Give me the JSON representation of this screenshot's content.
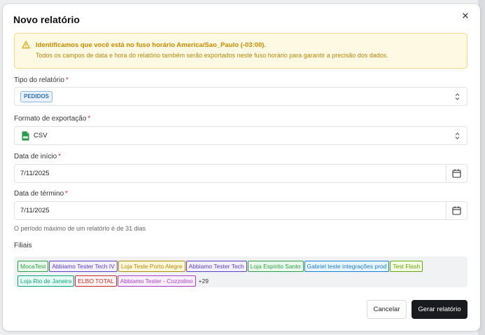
{
  "modal": {
    "title": "Novo relatório",
    "close_icon": "close-icon"
  },
  "alert": {
    "icon": "warning-triangle-icon",
    "title": "Identificamos que você está no fuso horário America/Sao_Paulo (-03:00).",
    "text": "Todos os campos de data e hora do relatório também serão exportados neste fuso horário para garantir a precisão dos dados."
  },
  "report_type": {
    "label": "Tipo do relatório",
    "required_mark": "*",
    "selected": "PEDIDOS",
    "icon": "chevron-up-down-icon"
  },
  "export_format": {
    "label": "Formato de exportação",
    "required_mark": "*",
    "selected": "CSV",
    "selected_icon": "csv-file-icon",
    "icon": "chevron-up-down-icon"
  },
  "start_date": {
    "label": "Data de início",
    "required_mark": "*",
    "value": "7/11/2025",
    "icon": "calendar-icon"
  },
  "end_date": {
    "label": "Data de término",
    "required_mark": "*",
    "value": "7/11/2025",
    "icon": "calendar-icon"
  },
  "helper_text": "O período máximo de um relatório é de 31 dias",
  "branches": {
    "label": "Filiais",
    "chips": [
      {
        "label": "MocaTest",
        "color": "#2f9e44",
        "bg": "#ebfbee"
      },
      {
        "label": "Abbiamo Tester Tech IV",
        "color": "#5f3dc4",
        "bg": "#f3f0ff"
      },
      {
        "label": "Loja Teste Porto Alegre",
        "color": "#b8860b",
        "bg": "#fff9db"
      },
      {
        "label": "Abbiamo Tester Tech",
        "color": "#5f3dc4",
        "bg": "#f3f0ff"
      },
      {
        "label": "Loja Espírito Santo",
        "color": "#2f9e44",
        "bg": "#ebfbee"
      },
      {
        "label": "Gabriel teste integrações prod",
        "color": "#1c7ed6",
        "bg": "#e7f5ff"
      },
      {
        "label": "Test Flash",
        "color": "#66a80f",
        "bg": "#f4fce3"
      },
      {
        "label": "Loja Rio de Janeiro",
        "color": "#0ca678",
        "bg": "#e6fcf5"
      },
      {
        "label": "ELBO TOTAL",
        "color": "#c92a2a",
        "bg": "#fff5f5"
      },
      {
        "label": "Abbiamo Tester - Cozzolino",
        "color": "#ae3ec9",
        "bg": "#f8f0fc"
      }
    ],
    "more": "+29"
  },
  "footer": {
    "cancel": "Cancelar",
    "generate": "Gerar relatório"
  },
  "colors": {
    "accent_dark": "#1a1b1e",
    "alert_bg": "#fdf9e3",
    "alert_text": "#c98a00",
    "required": "#e03131"
  }
}
